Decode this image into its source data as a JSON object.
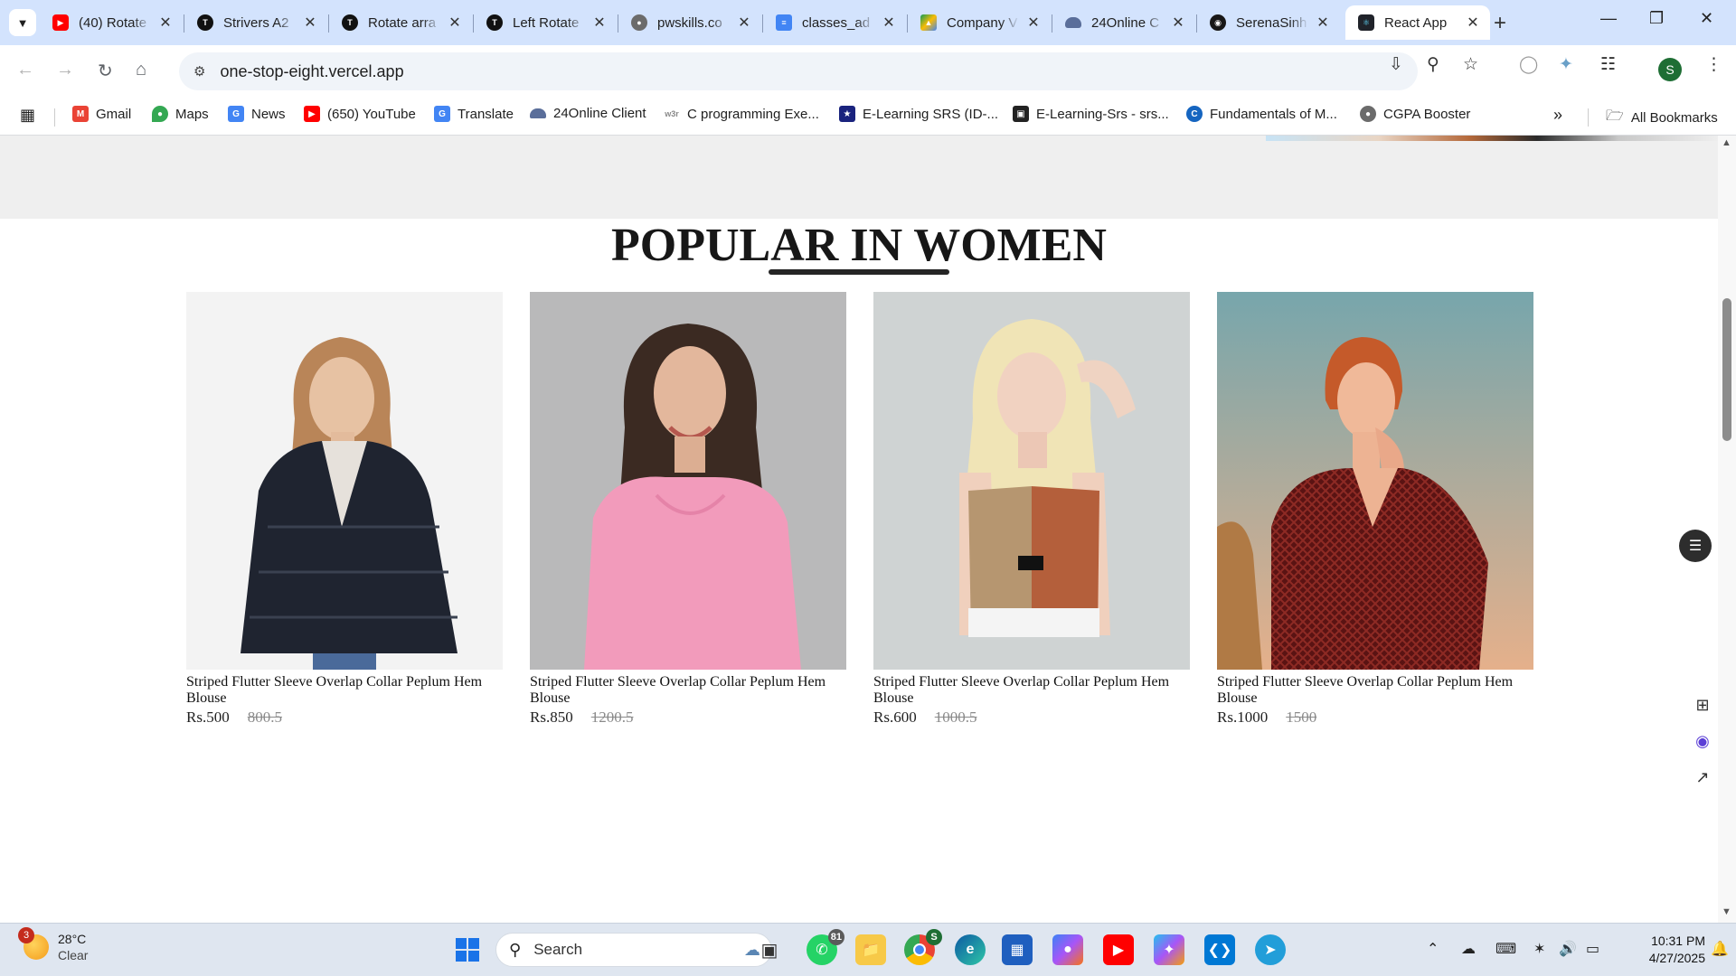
{
  "browser": {
    "tabs": [
      {
        "title": "(40) Rotate",
        "favicon": "youtube-icon",
        "color": "#ff0000"
      },
      {
        "title": "Strivers A2",
        "favicon": "tuf-icon",
        "color": "#111111"
      },
      {
        "title": "Rotate arra",
        "favicon": "tuf-icon",
        "color": "#111111"
      },
      {
        "title": "Left Rotate",
        "favicon": "tuf-icon",
        "color": "#111111"
      },
      {
        "title": "pwskills.co",
        "favicon": "globe-icon",
        "color": "#6b6b6b"
      },
      {
        "title": "classes_ad",
        "favicon": "docs-icon",
        "color": "#4285f4"
      },
      {
        "title": "Company V",
        "favicon": "drive-icon",
        "color": "#0f9d58"
      },
      {
        "title": "24Online C",
        "favicon": "cloud-icon",
        "color": "#5a6e9a"
      },
      {
        "title": "SerenaSinh",
        "favicon": "github-icon",
        "color": "#181717"
      },
      {
        "title": "React App",
        "favicon": "react-icon",
        "color": "#20232a"
      }
    ],
    "url": "one-stop-eight.vercel.app",
    "bookmarks": [
      {
        "label": "Gmail",
        "icon": "gmail-icon",
        "color": "#ea4335"
      },
      {
        "label": "Maps",
        "icon": "maps-icon",
        "color": "#34a853"
      },
      {
        "label": "News",
        "icon": "news-icon",
        "color": "#4285f4"
      },
      {
        "label": "(650) YouTube",
        "icon": "youtube-icon",
        "color": "#ff0000"
      },
      {
        "label": "Translate",
        "icon": "translate-icon",
        "color": "#4285f4"
      },
      {
        "label": "24Online Client",
        "icon": "cloud-icon",
        "color": "#5a6e9a"
      },
      {
        "label": "C programming Exe...",
        "icon": "w3r-icon",
        "color": "#888888"
      },
      {
        "label": "E-Learning SRS (ID-...",
        "icon": "star-icon",
        "color": "#1a237e"
      },
      {
        "label": "E-Learning-Srs - srs...",
        "icon": "learning-icon",
        "color": "#222222"
      },
      {
        "label": "Fundamentals of M...",
        "icon": "c-icon",
        "color": "#1565c0"
      },
      {
        "label": "CGPA Booster",
        "icon": "globe-icon",
        "color": "#6b6b6b"
      }
    ],
    "all_bookmarks": "All Bookmarks"
  },
  "page": {
    "section_title": "POPULAR IN WOMEN",
    "products": [
      {
        "name": "Striped Flutter Sleeve Overlap Collar Peplum Hem Blouse",
        "new_price": "Rs.500",
        "old_price": "800.5",
        "image": "woman-fur-jacket"
      },
      {
        "name": "Striped Flutter Sleeve Overlap Collar Peplum Hem Blouse",
        "new_price": "Rs.850",
        "old_price": "1200.5",
        "image": "woman-pink-top"
      },
      {
        "name": "Striped Flutter Sleeve Overlap Collar Peplum Hem Blouse",
        "new_price": "Rs.600",
        "old_price": "1000.5",
        "image": "woman-sports-top"
      },
      {
        "name": "Striped Flutter Sleeve Overlap Collar Peplum Hem Blouse",
        "new_price": "Rs.1000",
        "old_price": "1500",
        "image": "woman-red-blouse"
      }
    ]
  },
  "taskbar": {
    "weather_temp": "28°C",
    "weather_desc": "Clear",
    "weather_badge": "3",
    "search_label": "Search",
    "whatsapp_badge": "81",
    "chrome_badge": "S",
    "time": "10:31 PM",
    "date": "4/27/2025"
  }
}
